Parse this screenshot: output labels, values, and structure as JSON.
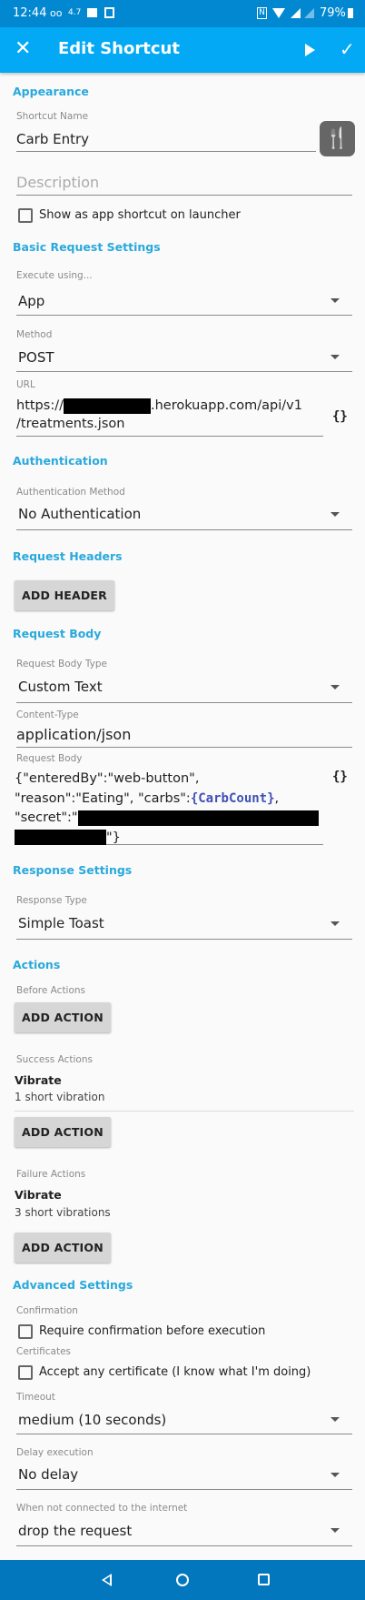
{
  "status_bar": {
    "time": "12:44",
    "speed": "4.7",
    "battery": "79%"
  },
  "app_bar": {
    "title": "Edit Shortcut",
    "icons": [
      "close-icon",
      "play-icon",
      "check-icon"
    ]
  },
  "appearance": {
    "header": "Appearance",
    "name_label": "Shortcut Name",
    "name_value": "Carb Entry",
    "description_placeholder": "Description",
    "launcher_checkbox": "Show as app shortcut on launcher",
    "launcher_checked": false,
    "shortcut_icon": "fork-knife-icon"
  },
  "basic": {
    "header": "Basic Request Settings",
    "execute_label": "Execute using...",
    "execute_value": "App",
    "method_label": "Method",
    "method_value": "POST",
    "url_label": "URL",
    "url_prefix": "https://",
    "url_line1_suffix": ".herokuapp.com/api/v1",
    "url_line2": "/treatments.json",
    "variable_button": "{}"
  },
  "auth": {
    "header": "Authentication",
    "method_label": "Authentication Method",
    "method_value": "No Authentication"
  },
  "headers": {
    "header": "Request Headers",
    "add_button": "ADD HEADER"
  },
  "body": {
    "header": "Request Body",
    "type_label": "Request Body Type",
    "type_value": "Custom Text",
    "content_type_label": "Content-Type",
    "content_type_value": "application/json",
    "body_label": "Request Body",
    "line1": "{\"enteredBy\":\"web-button\",",
    "line2a": "\"reason\":\"Eating\", \"carbs\":",
    "line2_var": "{CarbCount}",
    "line2b": ",",
    "line3": "\"secret\":\"",
    "line4_end": "\"}",
    "variable_button": "{}",
    "variable_color": "#3f51b5"
  },
  "response": {
    "header": "Response Settings",
    "type_label": "Response Type",
    "type_value": "Simple Toast"
  },
  "actions": {
    "header": "Actions",
    "before_label": "Before Actions",
    "success_label": "Success Actions",
    "success_item_title": "Vibrate",
    "success_item_desc": "1 short vibration",
    "failure_label": "Failure Actions",
    "failure_item_title": "Vibrate",
    "failure_item_desc": "3 short vibrations",
    "add_button": "ADD ACTION"
  },
  "advanced": {
    "header": "Advanced Settings",
    "confirmation_label": "Confirmation",
    "confirmation_checkbox": "Require confirmation before execution",
    "certificates_label": "Certificates",
    "certificates_checkbox": "Accept any certificate (I know what I'm doing)",
    "timeout_label": "Timeout",
    "timeout_value": "medium (10 seconds)",
    "delay_label": "Delay execution",
    "delay_value": "No delay",
    "offline_label": "When not connected to the internet",
    "offline_value": "drop the request"
  },
  "colors": {
    "app_bar": "#03a9f4",
    "status_bar": "#0288d1",
    "section_header": "#29a9dc",
    "nav_bar": "#0277bd"
  }
}
